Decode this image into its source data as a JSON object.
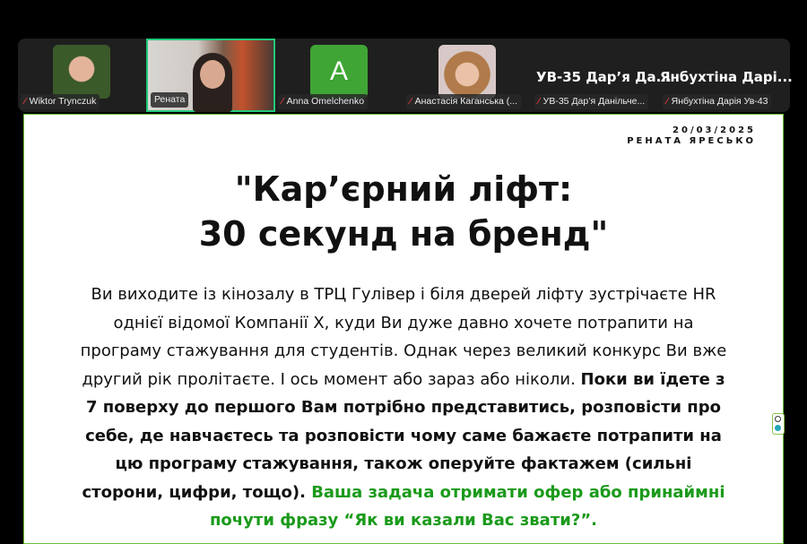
{
  "participants": [
    {
      "name": "Wiktor Trynczuk",
      "muted": true
    },
    {
      "name": "Рената",
      "muted": false,
      "active_speaker": true
    },
    {
      "name": "Anna Omelchenko",
      "muted": true,
      "initial": "A"
    },
    {
      "name": "Анастасія Каганська (...",
      "muted": true
    },
    {
      "name": "УВ-35 Дар’я Данільче...",
      "muted": true,
      "display": "УВ-35 Дар’я Да..."
    },
    {
      "name": "Янбухтіна Дарія Ув-43",
      "muted": true,
      "display": "Янбухтіна Дарі..."
    }
  ],
  "slide": {
    "date": "20/03/2025",
    "author": "РЕНАТА ЯРЕСЬКО",
    "title_line1": "\"Кар’єрний ліфт:",
    "title_line2": "30 секунд на бренд\"",
    "text_normal": "Ви виходите із кінозалу в ТРЦ Гулівер і біля дверей ліфту зустрічаєте HR однієї відомої Компанії Х, куди Ви дуже давно хочете потрапити на програму стажування для студентів. Однак через великий конкурс Ви вже другий рік пролітаєте. І ось момент або зараз або ніколи. ",
    "text_bold": "Поки ви їдете з 7 поверху до першого Вам потрібно представитись, розповісти про себе, де навчаєтесь та розповісти чому саме бажаєте потрапити на цю програму стажування, також оперуйте фактажем (сильні сторони, цифри, тощо). ",
    "text_green": "Ваша задача отримати офер або принаймні почути фразу “Як ви казали Вас звати?”."
  },
  "colors": {
    "accent_green": "#1a9a1a",
    "active_border": "#22c97a",
    "muted_red": "#e0393e"
  }
}
